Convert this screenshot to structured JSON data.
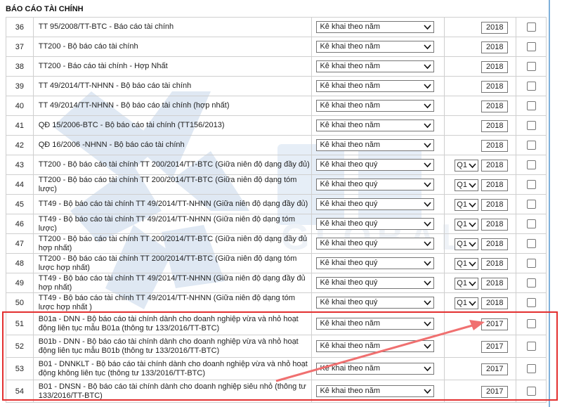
{
  "section_title": "BÁO CÁO TÀI CHÍNH",
  "watermark_text": [
    "BS",
    "GLOBAL"
  ],
  "rows": [
    {
      "no": "36",
      "name": "TT 95/2008/TT-BTC - Báo cáo tài chính",
      "select": "Kê khai theo năm",
      "quarter": "",
      "year": "2018"
    },
    {
      "no": "37",
      "name": "TT200 - Bộ báo cáo tài chính",
      "select": "Kê khai theo năm",
      "quarter": "",
      "year": "2018"
    },
    {
      "no": "38",
      "name": "TT200 - Báo cáo tài chính - Hợp Nhất",
      "select": "Kê khai theo năm",
      "quarter": "",
      "year": "2018"
    },
    {
      "no": "39",
      "name": "TT 49/2014/TT-NHNN - Bộ báo cáo tài chính",
      "select": "Kê khai theo năm",
      "quarter": "",
      "year": "2018"
    },
    {
      "no": "40",
      "name": "TT 49/2014/TT-NHNN - Bộ báo cáo tài chính (hợp nhất)",
      "select": "Kê khai theo năm",
      "quarter": "",
      "year": "2018"
    },
    {
      "no": "41",
      "name": "QĐ 15/2006-BTC - Bộ báo cáo tài chính (TT156/2013)",
      "select": "Kê khai theo năm",
      "quarter": "",
      "year": "2018"
    },
    {
      "no": "42",
      "name": "QĐ 16/2006 -NHNN - Bộ báo cáo tài chính",
      "select": "Kê khai theo năm",
      "quarter": "",
      "year": "2018"
    },
    {
      "no": "43",
      "name": "TT200 - Bộ báo cáo tài chính TT 200/2014/TT-BTC (Giữa niên độ dạng đầy đủ)",
      "select": "Kê khai theo quý",
      "quarter": "Q1",
      "year": "2018"
    },
    {
      "no": "44",
      "name": "TT200 - Bộ báo cáo tài chính TT 200/2014/TT-BTC (Giữa niên độ dạng tóm lược)",
      "select": "Kê khai theo quý",
      "quarter": "Q1",
      "year": "2018"
    },
    {
      "no": "45",
      "name": "TT49 - Bộ báo cáo tài chính TT 49/2014/TT-NHNN (Giữa niên độ dạng đầy đủ)",
      "select": "Kê khai theo quý",
      "quarter": "Q1",
      "year": "2018"
    },
    {
      "no": "46",
      "name": "TT49 - Bộ báo cáo tài chính TT 49/2014/TT-NHNN (Giữa niên độ dạng tóm lược)",
      "select": "Kê khai theo quý",
      "quarter": "Q1",
      "year": "2018"
    },
    {
      "no": "47",
      "name": "TT200 - Bộ báo cáo tài chính TT 200/2014/TT-BTC (Giữa niên độ dạng đầy đủ hợp nhất)",
      "select": "Kê khai theo quý",
      "quarter": "Q1",
      "year": "2018"
    },
    {
      "no": "48",
      "name": "TT200 - Bộ báo cáo tài chính TT 200/2014/TT-BTC (Giữa niên độ dạng tóm lược hợp nhất)",
      "select": "Kê khai theo quý",
      "quarter": "Q1",
      "year": "2018"
    },
    {
      "no": "49",
      "name": "TT49 - Bộ báo cáo tài chính TT 49/2014/TT-NHNN (Giữa niên độ dạng đầy đủ hợp nhất)",
      "select": "Kê khai theo quý",
      "quarter": "Q1",
      "year": "2018"
    },
    {
      "no": "50",
      "name": "TT49 - Bộ báo cáo tài chính TT 49/2014/TT-NHNN (Giữa niên độ dạng tóm lược hợp nhất )",
      "select": "Kê khai theo quý",
      "quarter": "Q1",
      "year": "2018"
    },
    {
      "no": "51",
      "name": "B01a - DNN - Bộ báo cáo tài chính dành cho doanh nghiệp vừa và nhỏ hoạt động liên tục mẫu B01a (thông tư 133/2016/TT-BTC)",
      "select": "Kê khai theo năm",
      "quarter": "",
      "year": "2017"
    },
    {
      "no": "52",
      "name": "B01b - DNN - Bộ báo cáo tài chính dành cho doanh nghiệp vừa và nhỏ hoạt động liên tục mẫu B01b (thông tư 133/2016/TT-BTC)",
      "select": "Kê khai theo năm",
      "quarter": "",
      "year": "2017"
    },
    {
      "no": "53",
      "name": "B01 - DNNKLT - Bộ báo cáo tài chính dành cho doanh nghiệp vừa và nhỏ hoạt động không liên tục (thông tư 133/2016/TT-BTC)",
      "select": "Kê khai theo năm",
      "quarter": "",
      "year": "2017"
    },
    {
      "no": "54",
      "name": "B01 - DNSN - Bộ báo cáo tài chính dành cho doanh nghiệp siêu nhỏ (thông tư 133/2016/TT-BTC)",
      "select": "Kê khai theo năm",
      "quarter": "",
      "year": "2017"
    }
  ],
  "footer_partial": "...",
  "colors": {
    "highlight": "#e33030",
    "watermark": "#4d7fb8",
    "border": "#cfcfcf"
  }
}
